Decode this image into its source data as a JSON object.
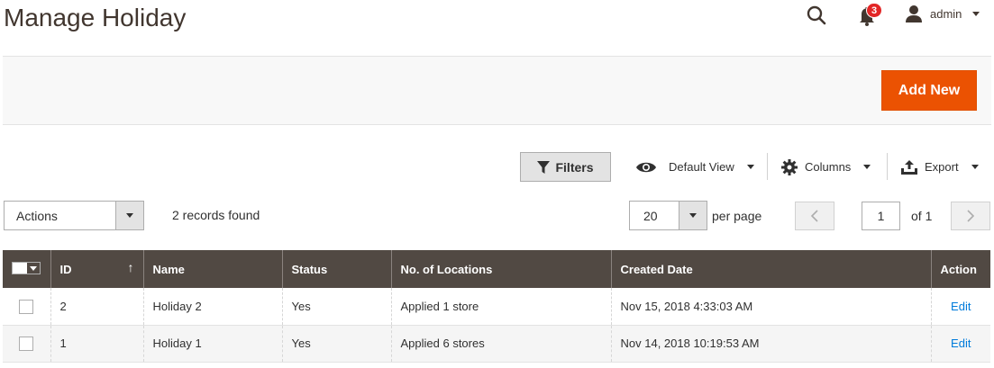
{
  "page": {
    "title": "Manage Holiday"
  },
  "header": {
    "notifications_count": "3",
    "user_name": "admin"
  },
  "action_bar": {
    "add_new_label": "Add New"
  },
  "toolbar": {
    "filters_label": "Filters",
    "view_label": "Default View",
    "columns_label": "Columns",
    "export_label": "Export"
  },
  "mass_actions": {
    "selected": "Actions"
  },
  "records": {
    "found_text": "2 records found"
  },
  "pagination": {
    "per_page_value": "20",
    "per_page_label": "per page",
    "current_page": "1",
    "of_label": "of 1"
  },
  "grid": {
    "columns": [
      "ID",
      "Name",
      "Status",
      "No. of Locations",
      "Created Date",
      "Action"
    ],
    "rows": [
      {
        "id": "2",
        "name": "Holiday 2",
        "status": "Yes",
        "locations": "Applied 1 store",
        "created": "Nov 15, 2018 4:33:03 AM",
        "action": "Edit"
      },
      {
        "id": "1",
        "name": "Holiday 1",
        "status": "Yes",
        "locations": "Applied 6 stores",
        "created": "Nov 14, 2018 10:19:53 AM",
        "action": "Edit"
      }
    ]
  },
  "colors": {
    "accent": "#eb5202",
    "grid_header": "#514943",
    "link": "#007bdb",
    "badge": "#e22626"
  },
  "icons": [
    "search-icon",
    "bell-icon",
    "user-icon",
    "filter-icon",
    "eye-icon",
    "gear-icon",
    "export-icon",
    "chevron-left-icon",
    "chevron-right-icon",
    "sort-up-icon"
  ]
}
